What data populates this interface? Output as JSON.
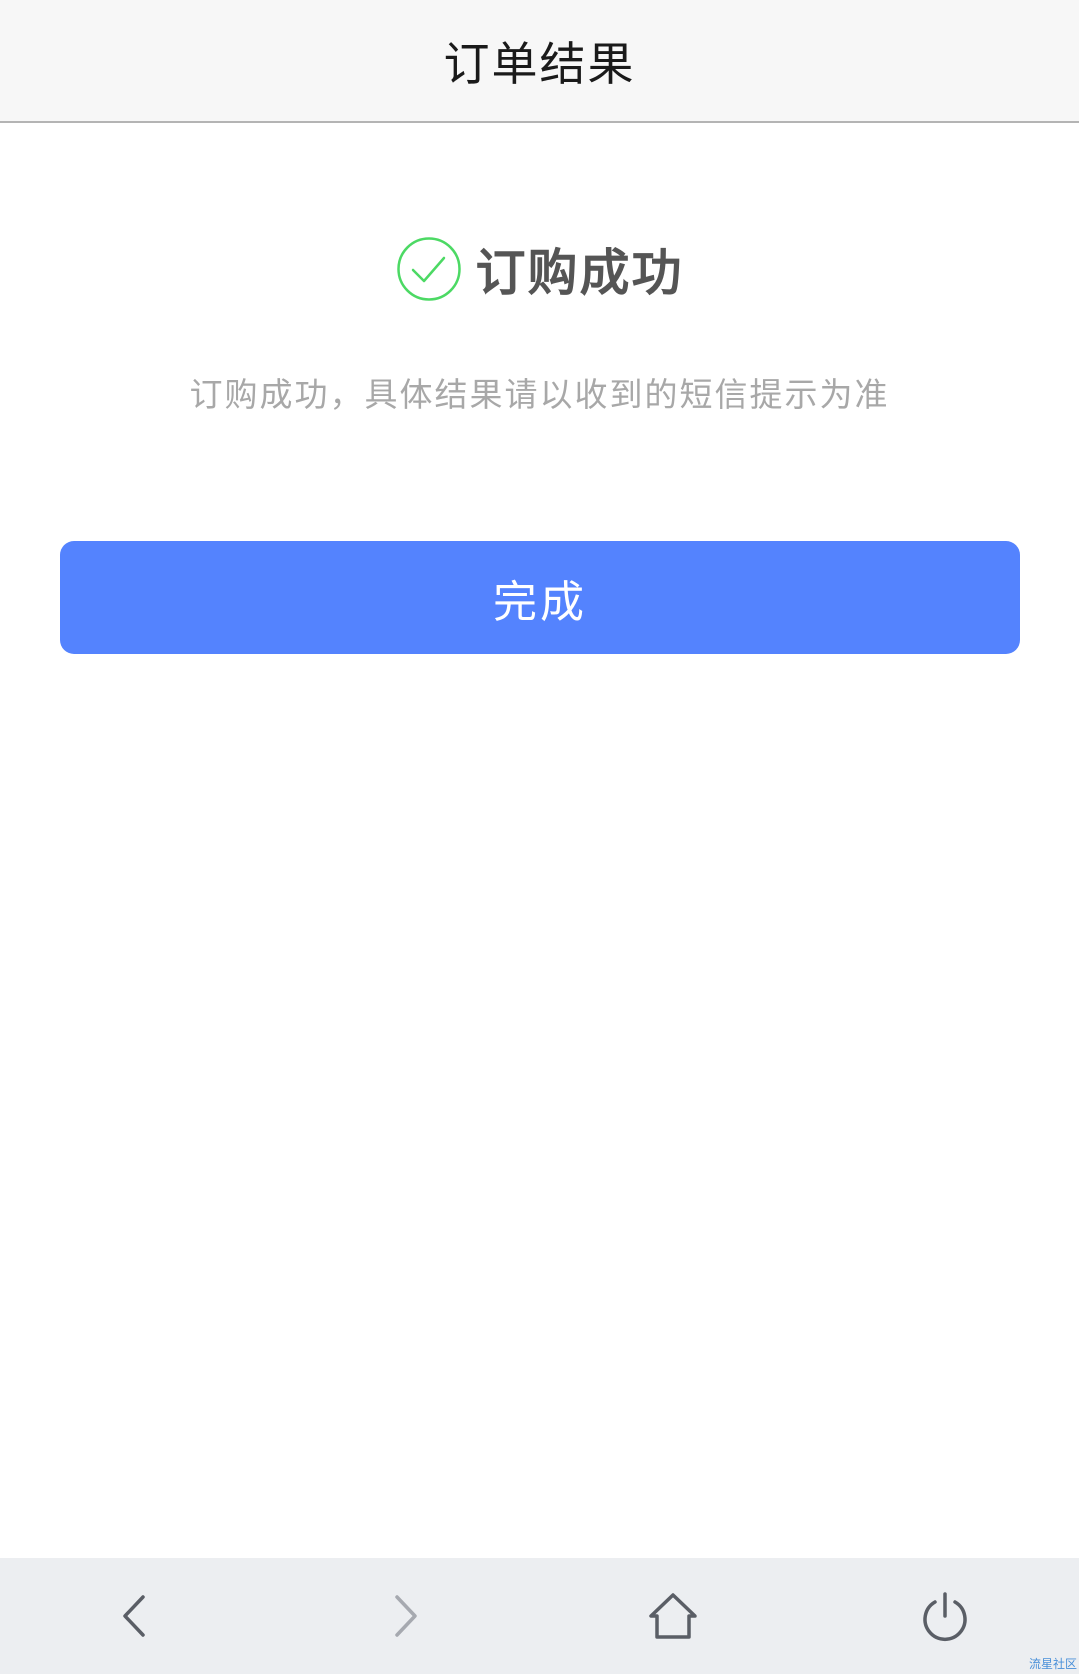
{
  "header": {
    "title": "订单结果"
  },
  "result": {
    "icon": "check-circle-icon",
    "icon_color": "#4cd964",
    "title": "订购成功",
    "description": "订购成功，具体结果请以收到的短信提示为准"
  },
  "actions": {
    "done_label": "完成",
    "done_color": "#5483fe"
  },
  "bottom_nav": {
    "items": [
      {
        "icon": "back-icon",
        "enabled": true
      },
      {
        "icon": "forward-icon",
        "enabled": false
      },
      {
        "icon": "home-icon",
        "enabled": true
      },
      {
        "icon": "power-icon",
        "enabled": true
      }
    ]
  },
  "watermark": "流星社区"
}
